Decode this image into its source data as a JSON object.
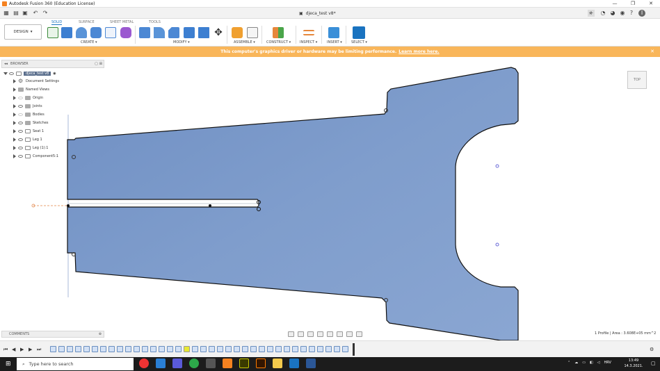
{
  "window": {
    "title": "Autodesk Fusion 360 (Education License)",
    "controls": [
      "—",
      "❐",
      "✕"
    ]
  },
  "document_tab": {
    "name": "djeca_test v8*",
    "close": "✕"
  },
  "workspace": {
    "label": "DESIGN",
    "arrow": "▾"
  },
  "toolbar_tabs": [
    "SOLID",
    "SURFACE",
    "SHEET METAL",
    "TOOLS"
  ],
  "toolbar_groups": [
    "CREATE ▾",
    "MODIFY ▾",
    "ASSEMBLE ▾",
    "CONSTRUCT ▾",
    "INSPECT ▾",
    "INSERT ▾",
    "SELECT ▾"
  ],
  "banner": {
    "message": "This computer's graphics driver or hardware may be limiting performance.",
    "link": "Learn more here.",
    "close": "✕"
  },
  "browser": {
    "title": "BROWSER",
    "root": "djeca_test v8",
    "items": [
      {
        "label": "Document Settings",
        "icon": "gear-icon"
      },
      {
        "label": "Named Views",
        "icon": "folder-icon"
      },
      {
        "label": "Origin",
        "icon": "folder-icon"
      },
      {
        "label": "Joints",
        "icon": "folder-icon"
      },
      {
        "label": "Bodies",
        "icon": "folder-icon"
      },
      {
        "label": "Sketches",
        "icon": "folder-icon"
      },
      {
        "label": "Seat 1",
        "icon": "component-icon"
      },
      {
        "label": "Leg 1",
        "icon": "component-icon"
      },
      {
        "label": "Leg (1):1",
        "icon": "component-icon"
      },
      {
        "label": "Component5:1",
        "icon": "component-icon"
      }
    ]
  },
  "viewcube": {
    "face": "TOP"
  },
  "comments": {
    "title": "COMMENTS"
  },
  "status": {
    "profile_info": "1 Profile | Area : 3.608E+05 mm^2"
  },
  "taskbar": {
    "search_placeholder": "Type here to search",
    "lang": "HRV",
    "time": "13:49",
    "date": "14.3.2021."
  },
  "colors": {
    "body_fill": "#7f9dcc",
    "banner": "#f9b65a",
    "accent": "#1a73c0",
    "taskbar": "#1c1c1c"
  }
}
